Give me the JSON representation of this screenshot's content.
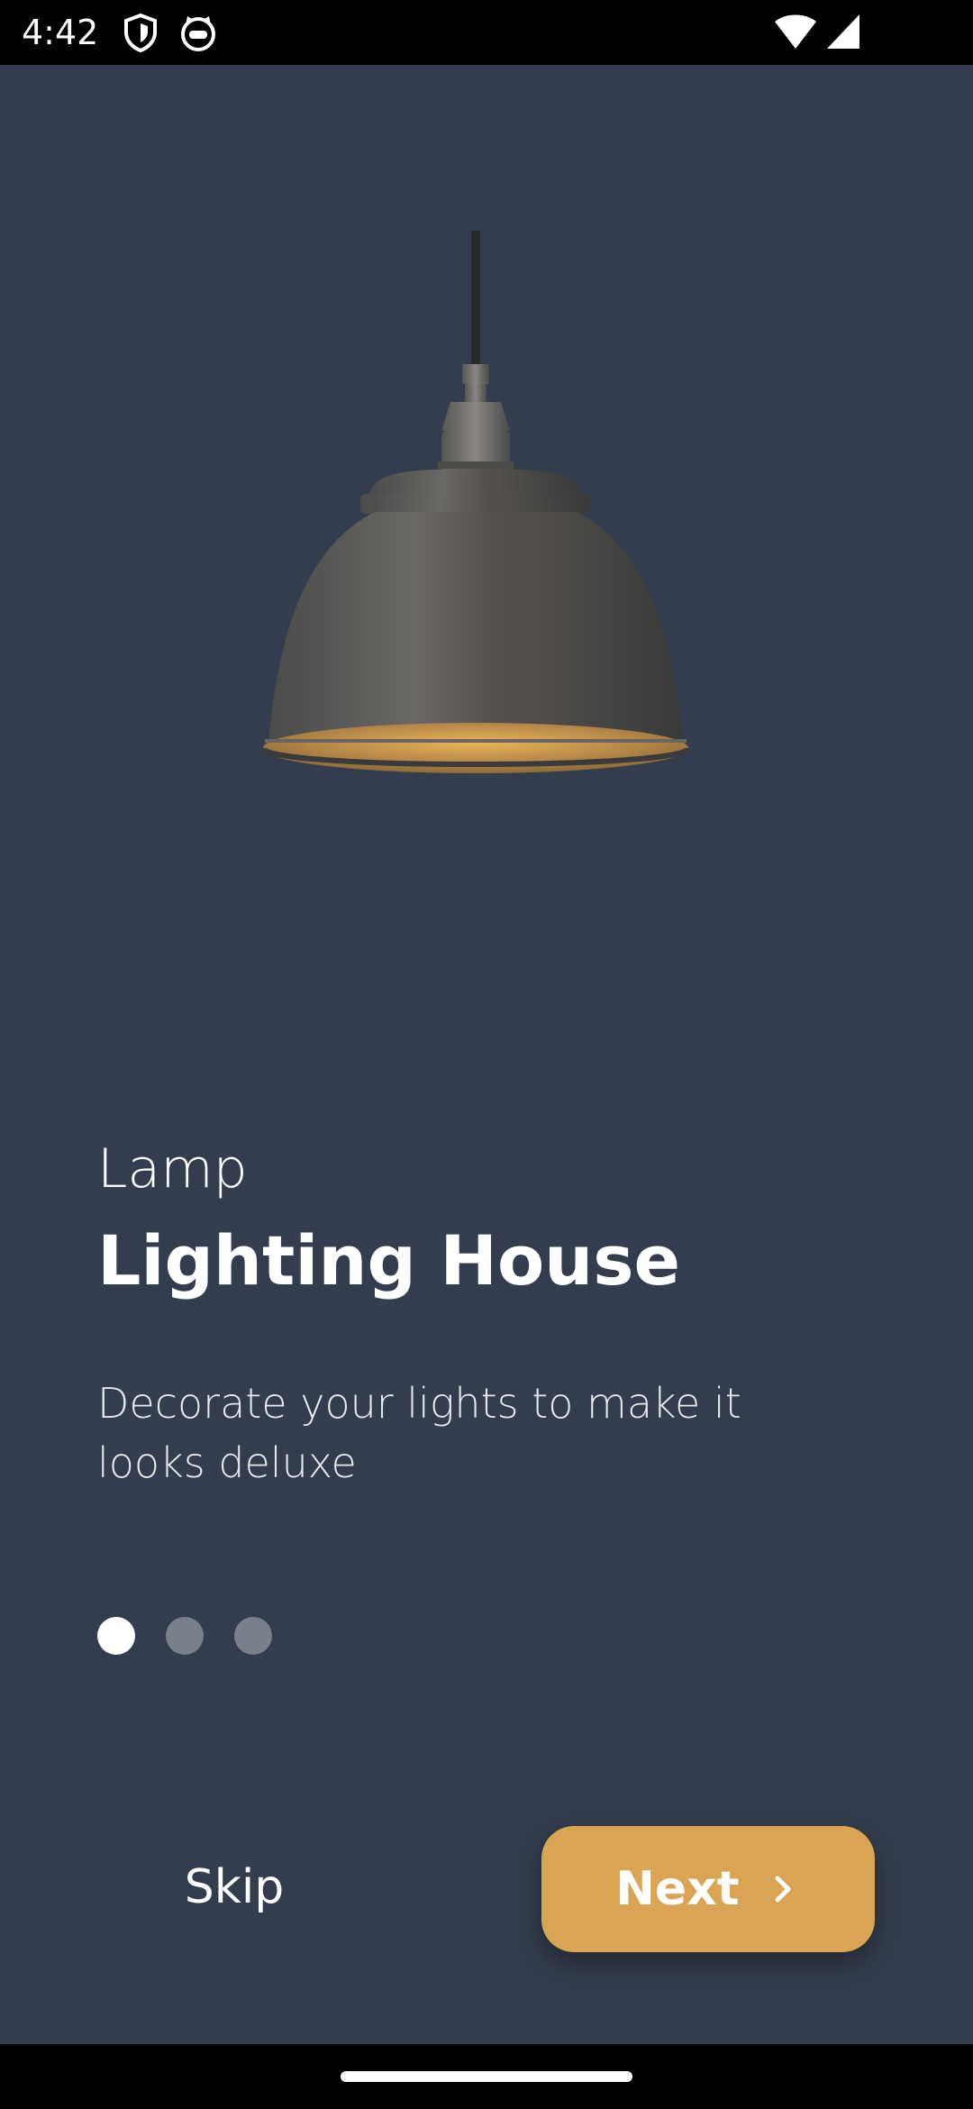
{
  "status_bar": {
    "time": "4:42",
    "icons_left": [
      "shield-icon",
      "cat-face-icon"
    ],
    "icons_right": [
      "wifi-icon",
      "cellular-signal-icon"
    ]
  },
  "onboarding": {
    "image_icon": "pendant-lamp-image",
    "category": "Lamp",
    "title": "Lighting House",
    "description": "Decorate your lights to make it looks deluxe",
    "page_indicator": {
      "total": 3,
      "current": 1
    }
  },
  "actions": {
    "skip_label": "Skip",
    "next_label": "Next",
    "next_icon": "chevron-right-icon"
  },
  "colors": {
    "background": "#343d4d",
    "accent": "#d9a453",
    "text": "#ffffff"
  }
}
